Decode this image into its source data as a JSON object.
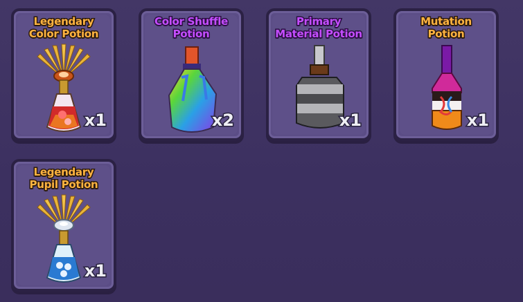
{
  "items": [
    {
      "name": "Legendary\nColor Potion",
      "count": "x1",
      "icon": "legendary-color-potion-icon"
    },
    {
      "name": "Color Shuffle\nPotion",
      "count": "x2",
      "icon": "color-shuffle-potion-icon"
    },
    {
      "name": "Primary\nMaterial Potion",
      "count": "x1",
      "icon": "primary-material-potion-icon"
    },
    {
      "name": "Mutation\nPotion",
      "count": "x1",
      "icon": "mutation-potion-icon"
    },
    {
      "name": "Legendary\nPupil Potion",
      "count": "x1",
      "icon": "legendary-pupil-potion-icon"
    }
  ],
  "colors": {
    "background": "#3f3360",
    "card": "#5b4d86",
    "title_orange": "#ffb340",
    "title_purple": "#c44dff"
  }
}
